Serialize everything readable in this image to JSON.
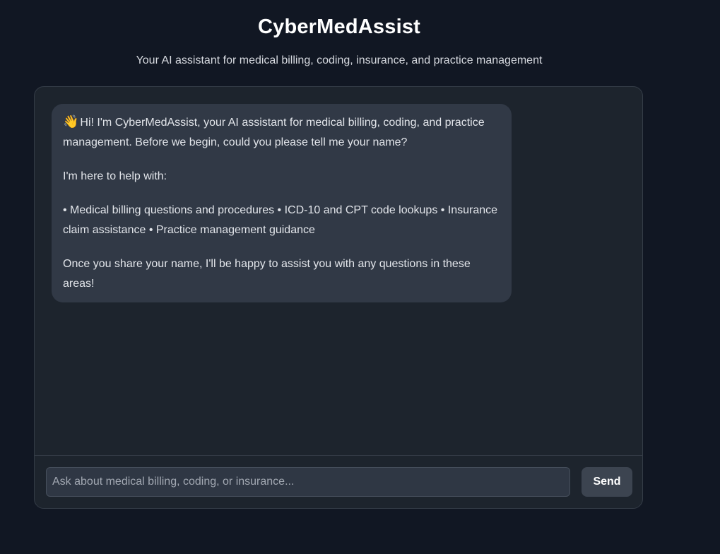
{
  "header": {
    "title": "CyberMedAssist",
    "subtitle": "Your AI assistant for medical billing, coding, insurance, and practice management"
  },
  "chat": {
    "messages": [
      {
        "role": "assistant",
        "icon": "waving-hand-icon",
        "emoji": "👋",
        "paragraphs": [
          "Hi! I'm CyberMedAssist, your AI assistant for medical billing, coding, and practice management. Before we begin, could you please tell me your name?",
          "I'm here to help with:",
          "• Medical billing questions and procedures • ICD-10 and CPT code lookups • Insurance claim assistance • Practice management guidance",
          "Once you share your name, I'll be happy to assist you with any questions in these areas!"
        ]
      }
    ]
  },
  "composer": {
    "placeholder": "Ask about medical billing, coding, or insurance...",
    "value": "",
    "send_label": "Send"
  },
  "colors": {
    "page_background": "#111723",
    "panel_background": "#1d242d",
    "bubble_background": "#313946",
    "input_background": "#2f3744",
    "button_background": "#3c4450"
  }
}
